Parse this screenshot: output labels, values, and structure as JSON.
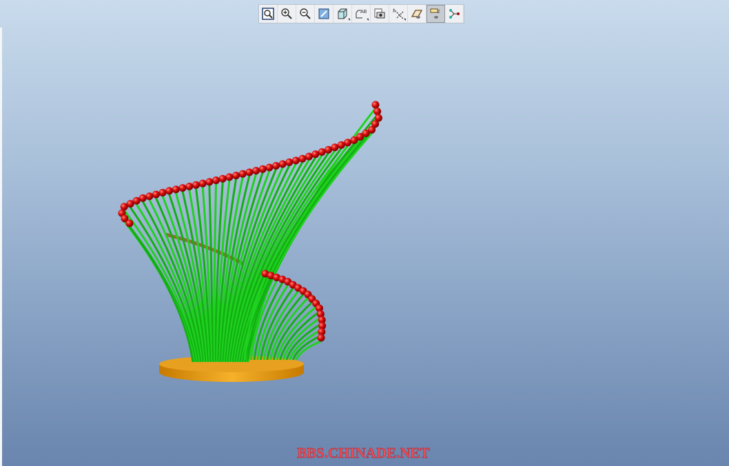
{
  "toolbar": {
    "buttons": [
      {
        "name": "refit",
        "icon": "zoom-fit-icon"
      },
      {
        "name": "zoom-in",
        "icon": "zoom-in-icon"
      },
      {
        "name": "zoom-out",
        "icon": "zoom-out-icon"
      },
      {
        "name": "repaint",
        "icon": "repaint-icon"
      },
      {
        "name": "display-style",
        "icon": "shaded-cube-icon"
      },
      {
        "name": "saved-views",
        "icon": "saved-views-icon"
      },
      {
        "name": "view-manager",
        "icon": "camera-icon"
      },
      {
        "name": "datum-display",
        "icon": "datum-display-icon"
      },
      {
        "name": "plane-display",
        "icon": "datum-plane-icon"
      },
      {
        "name": "axis-display",
        "icon": "axis-display-icon",
        "active": true
      },
      {
        "name": "point-display",
        "icon": "datum-point-icon"
      }
    ]
  },
  "watermark": "BBS.CHINADE.NET",
  "colors": {
    "strands": "#1fd21f",
    "beads": "#e01010",
    "base": "#e09a10",
    "watermark": "#e8505a"
  }
}
